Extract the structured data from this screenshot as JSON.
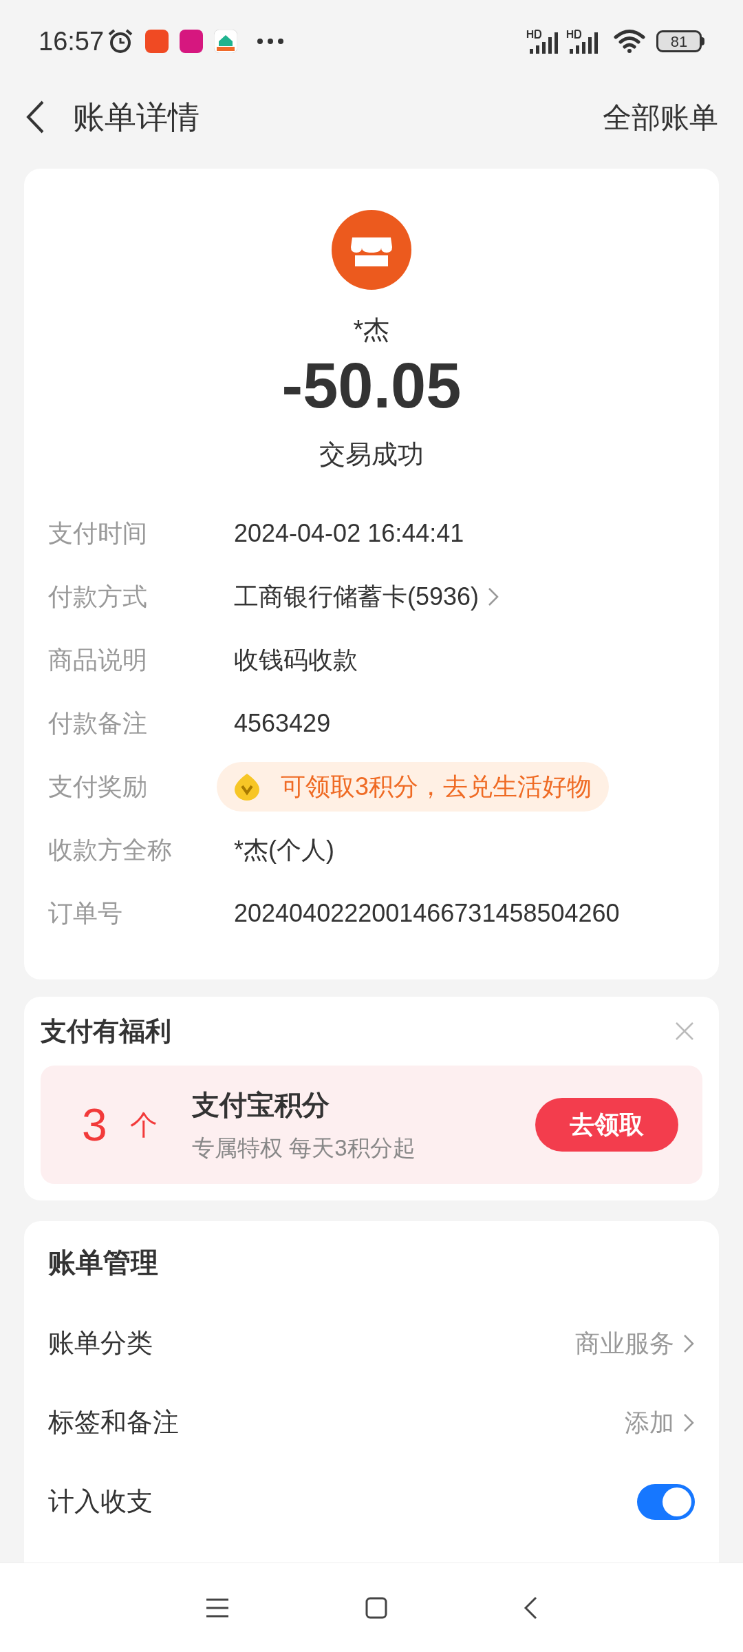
{
  "status_bar": {
    "time": "16:57",
    "battery": "81"
  },
  "header": {
    "title": "账单详情",
    "action": "全部账单"
  },
  "summary": {
    "payee": "*杰",
    "amount": "-50.05",
    "status": "交易成功"
  },
  "details": [
    {
      "kind": "text",
      "label": "支付时间",
      "value": "2024-04-02 16:44:41"
    },
    {
      "kind": "link",
      "label": "付款方式",
      "value": "工商银行储蓄卡(5936)"
    },
    {
      "kind": "text",
      "label": "商品说明",
      "value": "收钱码收款"
    },
    {
      "kind": "text",
      "label": "付款备注",
      "value": "4563429"
    },
    {
      "kind": "reward",
      "label": "支付奖励",
      "value": "可领取3积分，去兑生活好物"
    },
    {
      "kind": "text",
      "label": "收款方全称",
      "value": "*杰(个人)"
    },
    {
      "kind": "text",
      "label": "订单号",
      "value": "2024040222001466731458504260"
    }
  ],
  "benefit": {
    "title": "支付有福利",
    "count": "3",
    "unit": "个",
    "name": "支付宝积分",
    "description": "专属特权 每天3积分起",
    "button": "去领取"
  },
  "management": {
    "title": "账单管理",
    "rows": [
      {
        "kind": "link",
        "label": "账单分类",
        "value": "商业服务"
      },
      {
        "kind": "link",
        "label": "标签和备注",
        "value": "添加"
      },
      {
        "kind": "toggle",
        "label": "计入收支",
        "on": true
      }
    ]
  }
}
